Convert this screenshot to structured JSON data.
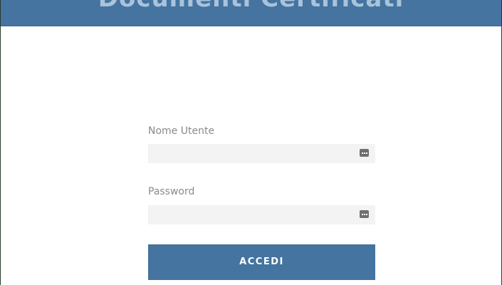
{
  "header": {
    "title": "Documenti Certificati"
  },
  "form": {
    "username_label": "Nome Utente",
    "username_value": "",
    "password_label": "Password",
    "password_value": "",
    "field_icon": "password-manager-icon",
    "submit_label": "ACCEDI"
  },
  "colors": {
    "accent": "#44749f",
    "input_background": "#f3f3f3",
    "label_text": "#8a8a8a"
  }
}
